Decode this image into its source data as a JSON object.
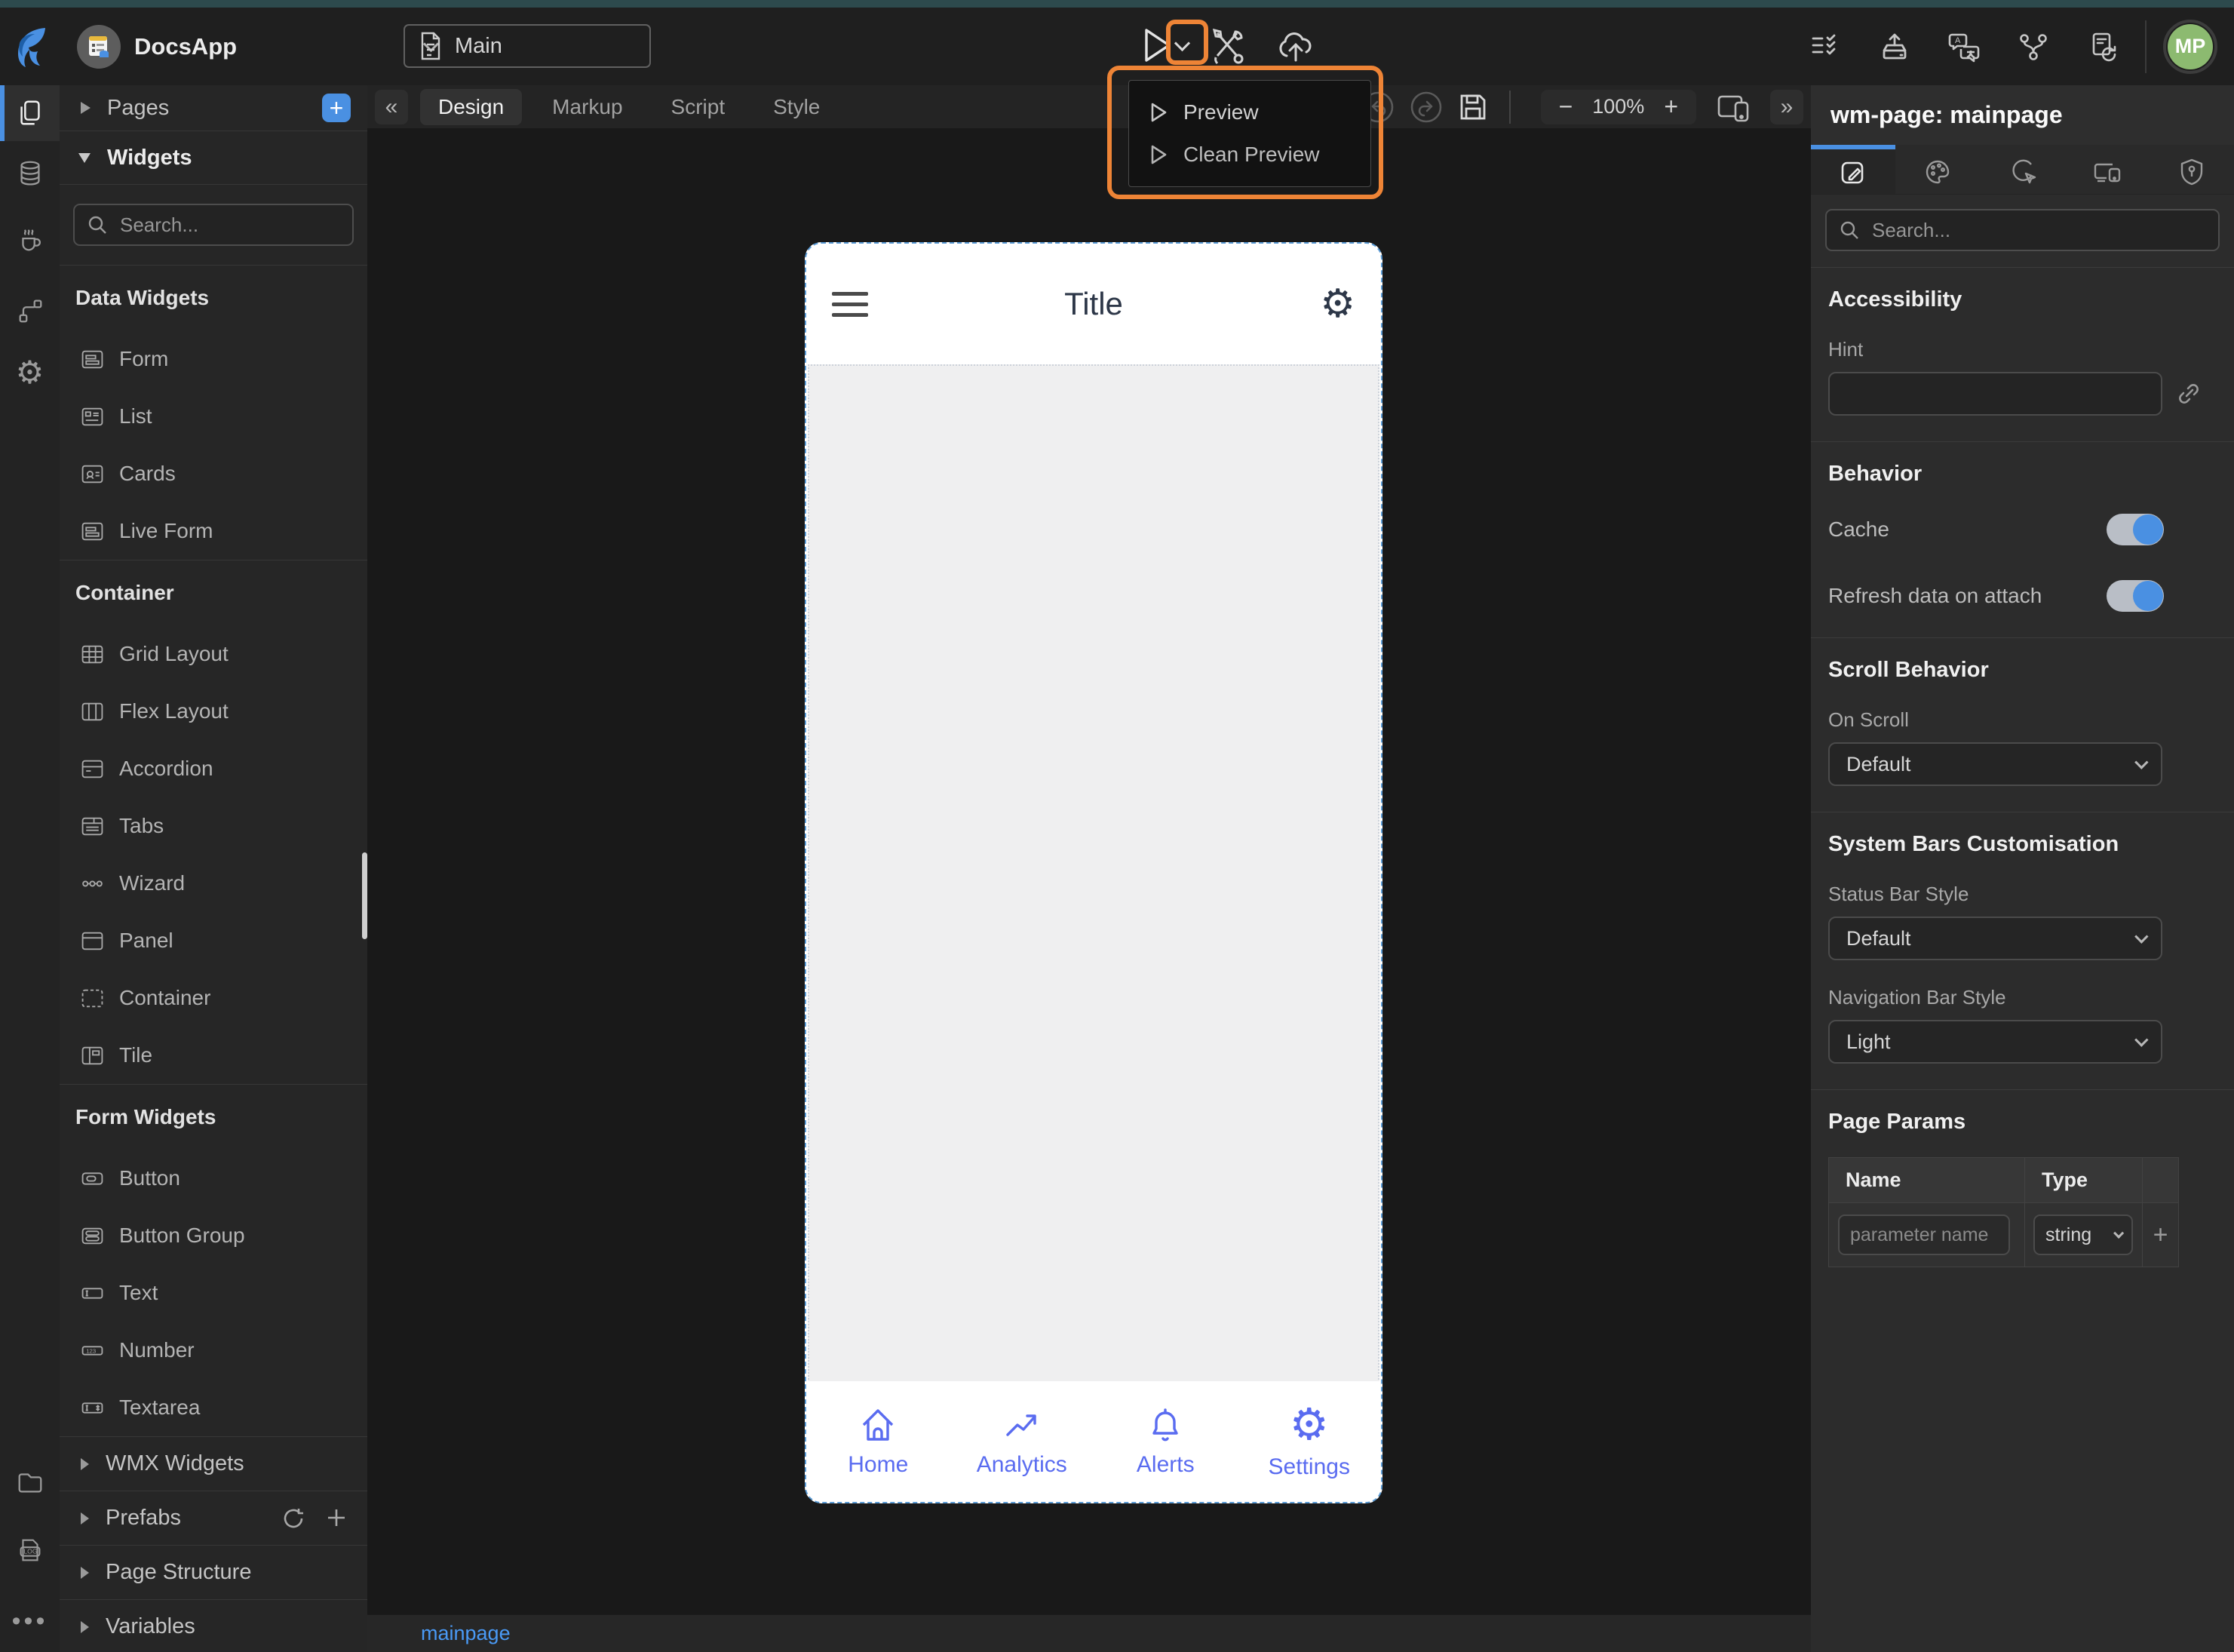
{
  "colors": {
    "accent_blue": "#4a90e2",
    "highlight_orange": "#ee8436",
    "avatar_green": "#8cba70",
    "phone_nav_blue": "#5a6cf0",
    "link_blue": "#4a9af5"
  },
  "topbar": {
    "app_name": "DocsApp",
    "page_selector": "Main",
    "preview_menu": {
      "items": [
        {
          "label": "Preview"
        },
        {
          "label": "Clean Preview"
        }
      ]
    },
    "right_icons": [
      {
        "name": "checklist"
      },
      {
        "name": "export"
      },
      {
        "name": "translate"
      },
      {
        "name": "version-branch"
      },
      {
        "name": "doc-sync"
      }
    ],
    "avatar_initials": "MP"
  },
  "rail": {
    "top": [
      {
        "name": "pages",
        "active": true
      },
      {
        "name": "database"
      },
      {
        "name": "java-services"
      },
      {
        "name": "connectors"
      },
      {
        "name": "settings"
      }
    ],
    "bottom": [
      {
        "name": "files"
      },
      {
        "name": "logs"
      },
      {
        "name": "more"
      }
    ]
  },
  "left_panel": {
    "pages_label": "Pages",
    "widgets_label": "Widgets",
    "search_placeholder": "Search...",
    "sections": [
      {
        "title": "Data Widgets",
        "items": [
          {
            "label": "Form",
            "icon": "form"
          },
          {
            "label": "List",
            "icon": "list"
          },
          {
            "label": "Cards",
            "icon": "cards"
          },
          {
            "label": "Live Form",
            "icon": "live-form"
          }
        ]
      },
      {
        "title": "Container",
        "items": [
          {
            "label": "Grid Layout",
            "icon": "grid-layout"
          },
          {
            "label": "Flex Layout",
            "icon": "flex-layout"
          },
          {
            "label": "Accordion",
            "icon": "accordion"
          },
          {
            "label": "Tabs",
            "icon": "tabs"
          },
          {
            "label": "Wizard",
            "icon": "wizard"
          },
          {
            "label": "Panel",
            "icon": "panel"
          },
          {
            "label": "Container",
            "icon": "container"
          },
          {
            "label": "Tile",
            "icon": "tile"
          }
        ]
      },
      {
        "title": "Form Widgets",
        "items": [
          {
            "label": "Button",
            "icon": "button"
          },
          {
            "label": "Button Group",
            "icon": "button-group"
          },
          {
            "label": "Text",
            "icon": "text"
          },
          {
            "label": "Number",
            "icon": "number"
          },
          {
            "label": "Textarea",
            "icon": "textarea"
          }
        ]
      }
    ],
    "collapsed": {
      "wmx": "WMX Widgets",
      "prefabs": "Prefabs",
      "page_structure": "Page Structure",
      "variables": "Variables"
    }
  },
  "canvas": {
    "tabs": [
      "Design",
      "Markup",
      "Script",
      "Style"
    ],
    "active_tab": "Design",
    "zoom_level": "100%",
    "breadcrumb": "mainpage",
    "phone": {
      "title": "Title",
      "nav": [
        {
          "label": "Home"
        },
        {
          "label": "Analytics"
        },
        {
          "label": "Alerts"
        },
        {
          "label": "Settings"
        }
      ]
    }
  },
  "right_panel": {
    "header": "wm-page: mainpage",
    "tabs": [
      {
        "name": "edit",
        "active": true
      },
      {
        "name": "palette"
      },
      {
        "name": "pointer"
      },
      {
        "name": "devices"
      },
      {
        "name": "shield"
      }
    ],
    "search_placeholder": "Search...",
    "accessibility": {
      "title": "Accessibility",
      "hint_label": "Hint",
      "hint_value": ""
    },
    "behavior": {
      "title": "Behavior",
      "cache_label": "Cache",
      "cache_on": true,
      "refresh_label": "Refresh data on attach",
      "refresh_on": true
    },
    "scroll": {
      "title": "Scroll Behavior",
      "on_scroll_label": "On Scroll",
      "on_scroll_value": "Default"
    },
    "system_bars": {
      "title": "System Bars Customisation",
      "status_label": "Status Bar Style",
      "status_value": "Default",
      "nav_label": "Navigation Bar Style",
      "nav_value": "Light"
    },
    "page_params": {
      "title": "Page Params",
      "name_header": "Name",
      "type_header": "Type",
      "param_placeholder": "parameter name",
      "type_value": "string"
    }
  }
}
